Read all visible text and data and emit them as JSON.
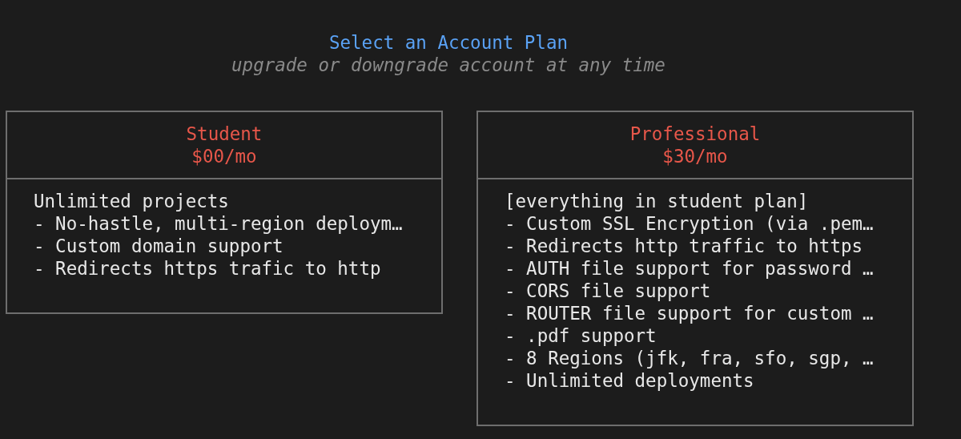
{
  "title": "Select an Account Plan",
  "subtitle": "upgrade or downgrade account at any time",
  "plans": [
    {
      "name": "Student",
      "price": "$00/mo",
      "features": [
        "Unlimited projects",
        "- No-hastle, multi-region deploym…",
        "- Custom domain support",
        "- Redirects https trafic to http"
      ]
    },
    {
      "name": "Professional",
      "price": "$30/mo",
      "features": [
        "[everything in student plan]",
        "- Custom SSL Encryption (via .pem…",
        "- Redirects http traffic to https",
        "- AUTH file support for password …",
        "- CORS file support",
        "- ROUTER file support for custom …",
        "- .pdf support",
        "- 8 Regions (jfk, fra, sfo, sgp, …",
        "- Unlimited deployments"
      ]
    }
  ]
}
